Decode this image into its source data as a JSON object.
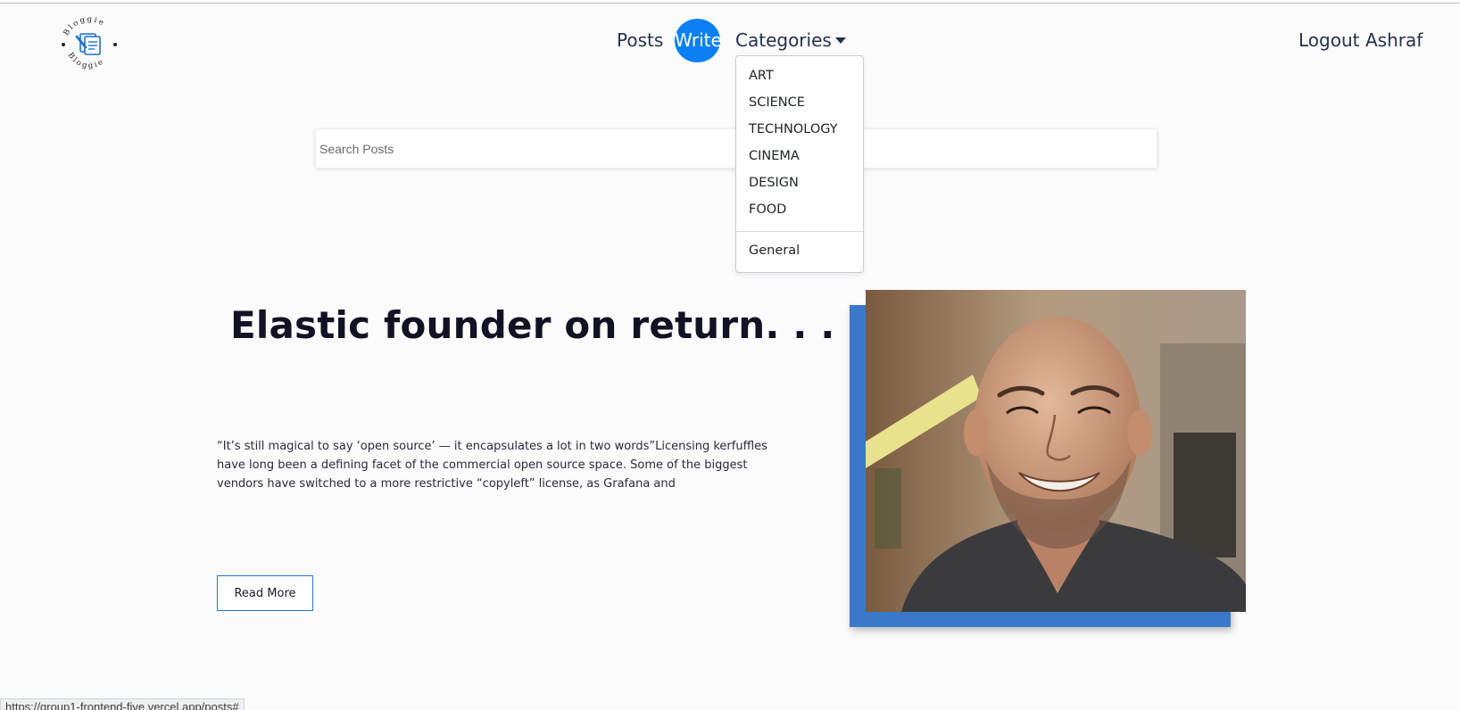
{
  "logo": {
    "text_top": "Bloggie",
    "text_bottom": "Bloggie"
  },
  "nav": {
    "posts": "Posts",
    "write": "Write",
    "categories": "Categories",
    "logout": "Logout",
    "user": "Ashraf"
  },
  "search": {
    "placeholder": "Search Posts",
    "value": ""
  },
  "categories_menu": {
    "items": [
      "ART",
      "SCIENCE",
      "TECHNOLOGY",
      "CINEMA",
      "DESIGN",
      "FOOD"
    ],
    "general": "General"
  },
  "post": {
    "title": "Elastic founder on return. . . .",
    "excerpt": "“It’s still magical to say ‘open source’ — it encapsulates a lot in two words”Licensing kerfuffles have long been a defining facet of the commercial open source space. Some of the biggest vendors have switched to a more restrictive “copyleft” license, as Grafana and",
    "read_more": "Read More"
  },
  "status_bar": {
    "url": "https://group1-frontend-five.vercel.app/posts#"
  },
  "colors": {
    "accent": "#0b80f5",
    "photo_frame": "#3a78c9"
  }
}
